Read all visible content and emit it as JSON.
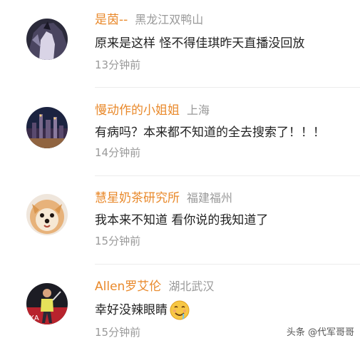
{
  "comments": [
    {
      "username": "是茵--",
      "location": "黑龙江双鸭山",
      "text": "原来是这样 怪不得佳琪昨天直播没回放",
      "time": "13分钟前",
      "avatar_icon": "avatar-dark-anime-icon"
    },
    {
      "username": "慢动作的小姐姐",
      "location": "上海",
      "text": "有病吗？本来都不知道的全去搜索了！！！",
      "time": "14分钟前",
      "avatar_icon": "avatar-city-night-icon"
    },
    {
      "username": "慧星奶茶研究所",
      "location": "福建福州",
      "text": "我本来不知道  看你说的我知道了",
      "time": "15分钟前",
      "avatar_icon": "avatar-pomeranian-dog-icon"
    },
    {
      "username": "Allen罗艾伦",
      "location": "湖北武汉",
      "text": "幸好没辣眼睛",
      "time": "15分钟前",
      "avatar_icon": "avatar-badminton-player-icon",
      "emoji": "drooling-face-emoji-icon"
    }
  ],
  "watermark": "头条 @代军哥哥",
  "colors": {
    "username": "#e9892b",
    "location": "#999999",
    "text": "#222222",
    "time": "#9a9a9a",
    "divider": "#ececec"
  }
}
